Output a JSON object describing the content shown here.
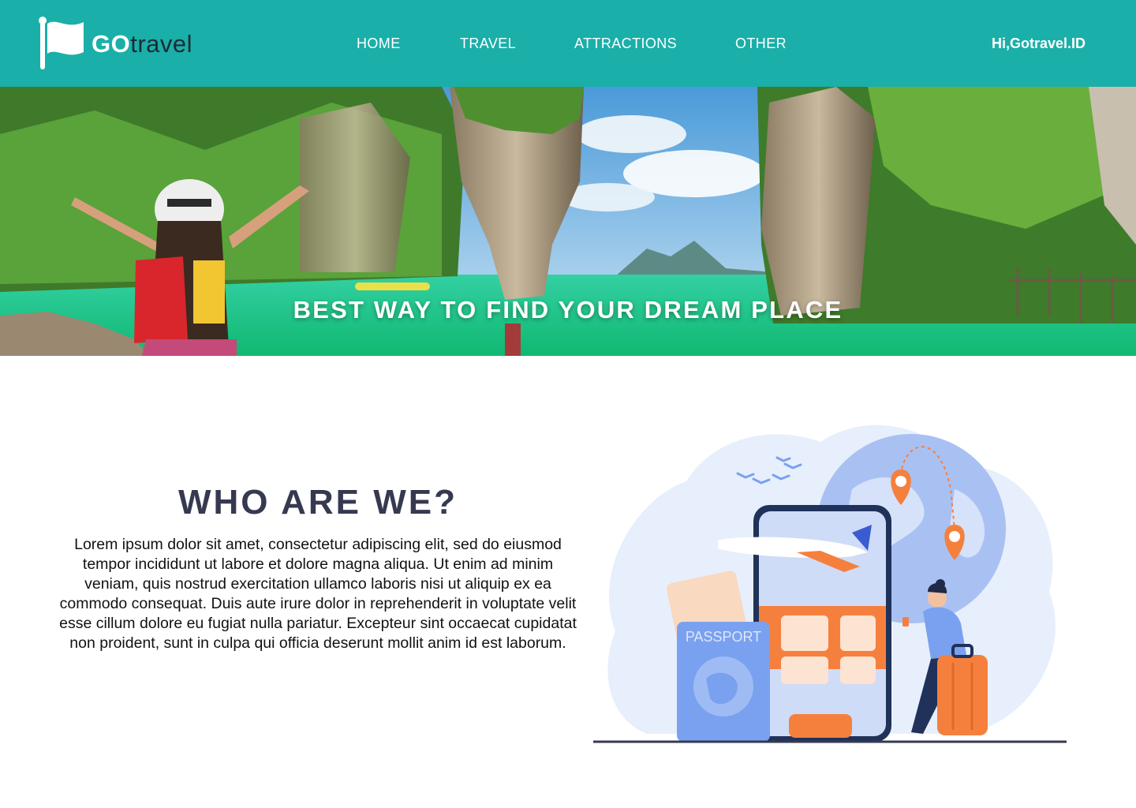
{
  "header": {
    "logo": {
      "go": "GO",
      "travel": "travel"
    },
    "nav": [
      {
        "label": "HOME"
      },
      {
        "label": "TRAVEL"
      },
      {
        "label": "ATTRACTIONS"
      },
      {
        "label": "OTHER"
      }
    ],
    "greeting": "Hi,Gotravel.ID"
  },
  "hero": {
    "title": "BEST WAY TO FIND YOUR DREAM PLACE"
  },
  "about": {
    "title": "WHO ARE WE?",
    "text": "Lorem ipsum dolor sit amet, consectetur adipiscing elit, sed do eiusmod tempor incididunt ut labore et dolore magna aliqua. Ut enim ad minim veniam, quis nostrud exercitation ullamco laboris nisi ut aliquip ex ea commodo consequat. Duis aute irure dolor in reprehenderit in voluptate velit esse cillum dolore eu fugiat nulla pariatur. Excepteur sint occaecat cupidatat non proident, sunt in culpa qui officia deserunt mollit anim id est laborum."
  },
  "illustration": {
    "passport_label": "PASSPORT"
  },
  "colors": {
    "brand": "#1aafa9",
    "heading": "#353a50",
    "accent_orange": "#f5803e",
    "accent_blue": "#7aa1f0"
  }
}
